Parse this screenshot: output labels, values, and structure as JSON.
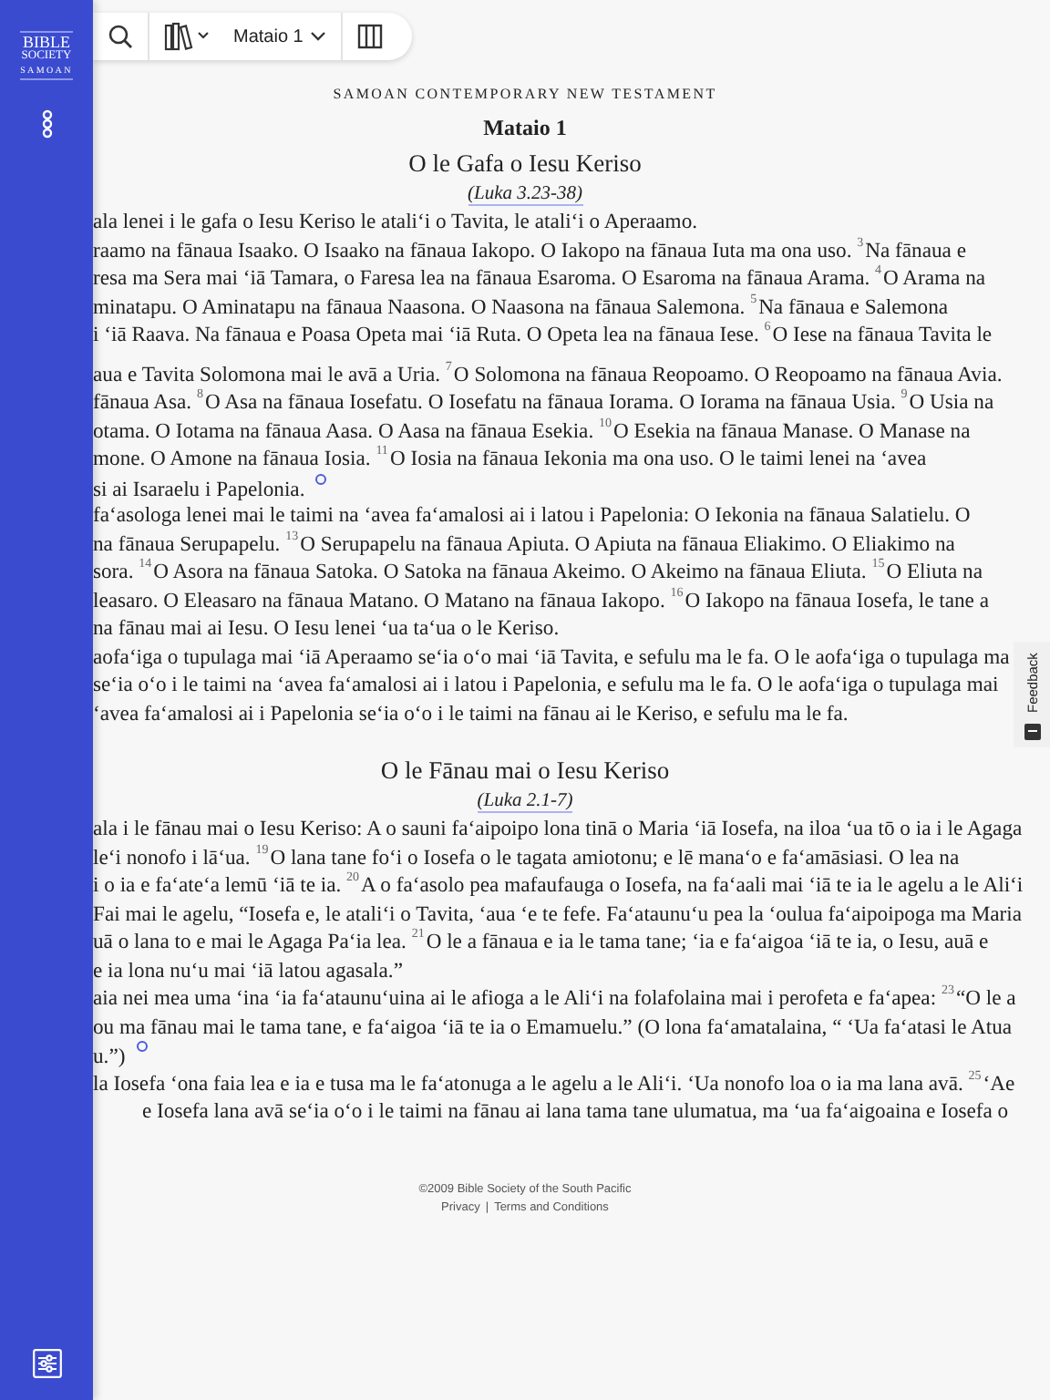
{
  "sidebar": {
    "logo": [
      "BIBLE",
      "SOCIETY",
      "SAMOAN"
    ]
  },
  "toolbar": {
    "book_chapter": "Mataio 1"
  },
  "bible": {
    "version": "SAMOAN CONTEMPORARY NEW TESTAMENT",
    "chapter": "Mataio 1",
    "sections": [
      {
        "heading": "O le Gafa o Iesu Keriso",
        "reference": "(Luka 3.23-38)",
        "lines": [
          {
            "kind": "line",
            "footnote": false,
            "text": "ala lenei i le gafa o Iesu Keriso le atali‘i o Tavita, le atali‘i o Aperaamo."
          },
          {
            "kind": "line",
            "footnote": false,
            "text": "raamo na fānaua Isaako. O Isaako na fānaua Iakopo. O Iakopo na fānaua Iuta ma ona uso. $^{3}$Na fānaua e"
          },
          {
            "kind": "line",
            "footnote": false,
            "text": "resa ma Sera mai ‘iā Tamara, o Faresa lea na fānaua Esaroma. O Esaroma na fānaua Arama. $^{4}$O Arama na"
          },
          {
            "kind": "line",
            "footnote": false,
            "text": "minatapu. O Aminatapu na fānaua Naasona. O Naasona na fānaua Salemona. $^{5}$Na fānaua e Salemona"
          },
          {
            "kind": "line",
            "footnote": false,
            "text": "i ‘iā Raava. Na fānaua e Poasa Opeta mai ‘iā Ruta. O Opeta lea na fānaua Iese. $^{6}$O Iese na fānaua Tavita le"
          },
          {
            "kind": "blank"
          },
          {
            "kind": "line",
            "footnote": false,
            "text": "aua e Tavita Solomona mai le avā a Uria. $^{7}$O Solomona na fānaua Reopoamo. O Reopoamo na fānaua Avia."
          },
          {
            "kind": "line",
            "footnote": false,
            "text": "fānaua Asa. $^{8}$O Asa na fānaua Iosefatu. O Iosefatu na fānaua Iorama. O Iorama na fānaua Usia. $^{9}$O Usia na"
          },
          {
            "kind": "line",
            "footnote": false,
            "text": "otama. O Iotama na fānaua Aasa. O Aasa na fānaua Esekia. $^{10}$O Esekia na fānaua Manase. O Manase na"
          },
          {
            "kind": "line",
            "footnote": false,
            "text": "mone. O Amone na fānaua Iosia. $^{11}$O Iosia na fānaua Iekonia ma ona uso. O le taimi lenei na ‘avea"
          },
          {
            "kind": "line",
            "footnote": true,
            "text": "si ai Isaraelu i Papelonia."
          },
          {
            "kind": "line",
            "footnote": false,
            "text": "fa‘asologa lenei mai le taimi na ‘avea fa‘amalosi ai i latou i Papelonia: O Iekonia na fānaua Salatielu. O"
          },
          {
            "kind": "line",
            "footnote": false,
            "text": "na fānaua Serupapelu. $^{13}$O Serupapelu na fānaua Apiuta. O Apiuta na fānaua Eliakimo. O Eliakimo na"
          },
          {
            "kind": "line",
            "footnote": false,
            "text": "sora. $^{14}$O Asora na fānaua Satoka. O Satoka na fānaua Akeimo. O Akeimo na fānaua Eliuta. $^{15}$O Eliuta na"
          },
          {
            "kind": "line",
            "footnote": false,
            "text": "leasaro. O Eleasaro na fānaua Matano. O Matano na fānaua Iakopo. $^{16}$O Iakopo na fānaua Iosefa, le tane a"
          },
          {
            "kind": "line",
            "footnote": false,
            "text": "na fānau mai ai Iesu. O Iesu lenei ‘ua ta‘ua o le Keriso."
          },
          {
            "kind": "line",
            "footnote": false,
            "text": "aofa‘iga o tupulaga mai ‘iā Aperaamo se‘ia o‘o mai ‘iā Tavita, e sefulu ma le fa. O le aofa‘iga o tupulaga ma"
          },
          {
            "kind": "line",
            "footnote": false,
            "text": "se‘ia o‘o i le taimi na ‘avea fa‘amalosi ai i latou i Papelonia, e sefulu ma le fa. O le aofa‘iga o tupulaga mai"
          },
          {
            "kind": "line",
            "footnote": false,
            "text": "‘avea fa‘amalosi ai i Papelonia se‘ia o‘o i le taimi na fānau ai le Keriso, e sefulu ma le fa."
          }
        ]
      },
      {
        "heading": "O le Fānau mai o Iesu Keriso",
        "reference": "(Luka 2.1-7)",
        "lines": [
          {
            "kind": "line",
            "footnote": false,
            "text": "ala i le fānau mai o Iesu Keriso: A o sauni fa‘aipoipo lona tinā o Maria ‘iā Iosefa, na iloa ‘ua tō o ia i le Agaga"
          },
          {
            "kind": "line",
            "footnote": false,
            "text": "le‘i nonofo i lā‘ua. $^{19}$O lana tane fo‘i o Iosefa o le tagata amiotonu; e lē mana‘o e fa‘amāsiasi. O lea na"
          },
          {
            "kind": "line",
            "footnote": false,
            "text": "i o ia e fa‘ate‘a lemū ‘iā te ia. $^{20}$A o fa‘asolo pea mafaufauga o Iosefa, na fa‘aali mai ‘iā te ia le agelu a le Ali‘i"
          },
          {
            "kind": "line",
            "footnote": false,
            "text": "Fai mai le agelu, “Iosefa e, le atali‘i o Tavita, ‘aua ‘e te fefe. Fa‘ataunu‘u pea la ‘oulua fa‘aipoipoga ma Maria"
          },
          {
            "kind": "line",
            "footnote": false,
            "text": "uā o lana to e mai le Agaga Pa‘ia lea. $^{21}$O le a fānaua e ia le tama tane; ‘ia e fa‘aigoa ‘iā te ia, o Iesu, auā e"
          },
          {
            "kind": "line",
            "footnote": false,
            "text": "e ia lona nu‘u mai ‘iā latou agasala.”"
          },
          {
            "kind": "line",
            "footnote": false,
            "text": "aia nei mea uma ‘ina ‘ia fa‘ataunu‘uina ai le afioga a le Ali‘i na folafolaina mai i perofeta e fa‘apea: $^{23}$“O le a"
          },
          {
            "kind": "line",
            "footnote": false,
            "text": "ou ma fānau mai le tama tane, e fa‘aigoa ‘iā te ia o Emamuelu.” (O lona fa‘amatalaina, “ ‘Ua fa‘atasi le Atua"
          },
          {
            "kind": "line",
            "footnote": true,
            "text": "u.”)"
          },
          {
            "kind": "line",
            "footnote": false,
            "text": "la Iosefa ‘ona faia lea e ia e tusa ma le fa‘atonuga a le agelu a le Ali‘i. ‘Ua nonofo loa o ia ma lana avā. $^{25}$‘Ae"
          },
          {
            "kind": "indent",
            "footnote": false,
            "text": "e Iosefa lana avā se‘ia o‘o i le taimi na fānau ai lana tama tane ulumatua, ma ‘ua fa‘aigoaina e Iosefa o"
          }
        ]
      }
    ]
  },
  "feedback": {
    "label": "Feedback"
  },
  "footer": {
    "copyright": "©2009 Bible Society of the South Pacific",
    "links": [
      "Privacy",
      "Terms and Conditions"
    ],
    "separator": "|"
  }
}
